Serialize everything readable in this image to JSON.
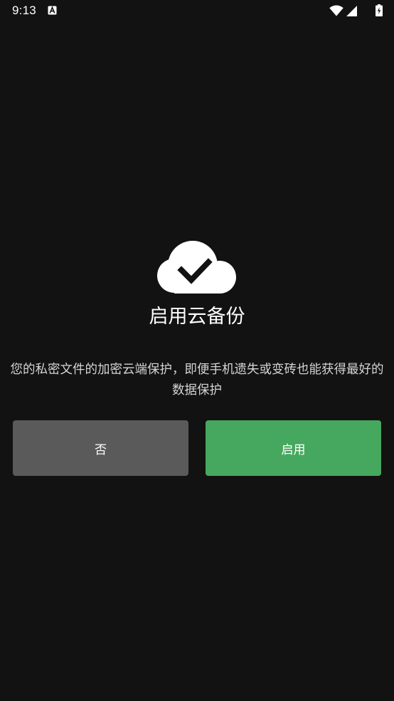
{
  "status_bar": {
    "time": "9:13",
    "notification_icon": "a-badge-icon",
    "icons": [
      "wifi-icon",
      "cellular-signal-icon",
      "battery-charging-icon"
    ]
  },
  "dialog": {
    "icon": "cloud-check-icon",
    "title": "启用云备份",
    "description": "您的私密文件的加密云端保护，即便手机遗失或变砖也能获得最好的数据保护",
    "buttons": {
      "no_label": "否",
      "enable_label": "启用"
    }
  },
  "colors": {
    "background": "#121212",
    "no_button": "#5a5a5a",
    "enable_button": "#46a85e",
    "text": "#ffffff"
  }
}
